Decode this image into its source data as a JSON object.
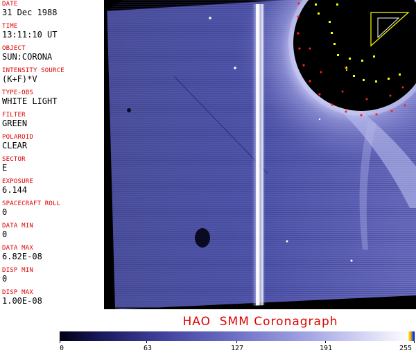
{
  "sidebar": {
    "fields": [
      {
        "label": "DATE",
        "value": "31 Dec 1988"
      },
      {
        "label": "TIME",
        "value": "13:11:10 UT"
      },
      {
        "label": "OBJECT",
        "value": "SUN:CORONA"
      },
      {
        "label": "INTENSITY SOURCE",
        "value": "(K+F)*V"
      },
      {
        "label": "TYPE-OBS",
        "value": "WHITE LIGHT"
      },
      {
        "label": "FILTER",
        "value": "GREEN"
      },
      {
        "label": "POLAROID",
        "value": "CLEAR"
      },
      {
        "label": "SECTOR",
        "value": "E"
      },
      {
        "label": "EXPOSURE",
        "value": "6.144"
      },
      {
        "label": "SPACECRAFT ROLL",
        "value": "0"
      },
      {
        "label": "DATA MIN",
        "value": "0"
      },
      {
        "label": "DATA MAX",
        "value": "6.82E-08"
      },
      {
        "label": "DISP MIN",
        "value": "0"
      },
      {
        "label": "DISP MAX",
        "value": "1.00E-08"
      }
    ]
  },
  "footer": {
    "title": "HAO  SMM Coronagraph"
  },
  "colorbar": {
    "ticks": [
      "0",
      "63",
      "127",
      "191",
      "255"
    ],
    "range": [
      0,
      255
    ],
    "colors": {
      "low": "#000014",
      "mid": "#6a6cc4",
      "high": "#ffffff"
    }
  },
  "image": {
    "colors": {
      "background": "#000000",
      "field": "#4a4fa8",
      "label_red": "#e00000",
      "marker_yellow": "#ffff00",
      "marker_red": "#ff2020"
    }
  }
}
